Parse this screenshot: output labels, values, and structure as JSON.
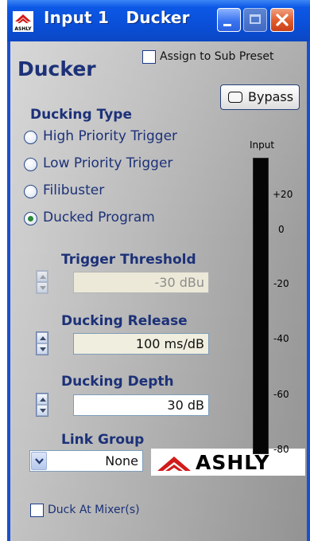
{
  "window": {
    "title": "Input 1   Ducker",
    "colors": {
      "titlebar": "#0a4fd8",
      "close": "#e05a2a",
      "heading": "#1c3178"
    }
  },
  "icons": {
    "app": "ashly-app-icon",
    "minimize": "minimize-icon",
    "maximize": "maximize-icon",
    "close": "close-icon"
  },
  "panel": {
    "heading": "Ducker",
    "assign_label": "Assign to Sub Preset",
    "assign_checked": false,
    "bypass_label": "Bypass"
  },
  "ducking_type": {
    "label": "Ducking Type",
    "options": [
      {
        "label": "High Priority Trigger",
        "selected": false
      },
      {
        "label": "Low Priority Trigger",
        "selected": false
      },
      {
        "label": "Filibuster",
        "selected": false
      },
      {
        "label": "Ducked Program",
        "selected": true
      }
    ]
  },
  "fields": {
    "trigger_threshold": {
      "label": "Trigger Threshold",
      "value": "-30 dBu",
      "enabled": false
    },
    "ducking_release": {
      "label": "Ducking Release",
      "value": "100 ms/dB",
      "enabled": true
    },
    "ducking_depth": {
      "label": "Ducking Depth",
      "value": "30 dB",
      "enabled": true
    }
  },
  "link_group": {
    "label": "Link Group",
    "value": "None"
  },
  "logo": {
    "text": "ASHLY"
  },
  "duck_at_mixer": {
    "label": "Duck At Mixer(s)",
    "checked": false
  },
  "meter": {
    "label": "Input",
    "ticks": [
      "+20",
      "0",
      "-20",
      "-40",
      "-60",
      "-80"
    ],
    "level": 0
  }
}
